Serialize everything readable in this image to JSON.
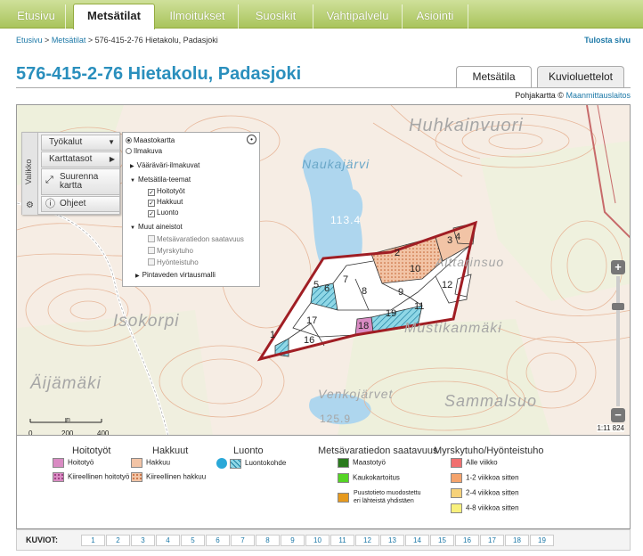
{
  "nav": {
    "tabs": [
      {
        "label": "Etusivu"
      },
      {
        "label": "Metsätilat"
      },
      {
        "label": "Ilmoitukset"
      },
      {
        "label": "Suosikit"
      },
      {
        "label": "Vahtipalvelu"
      },
      {
        "label": "Asiointi"
      }
    ],
    "active_index": 1
  },
  "breadcrumb": {
    "items": [
      "Etusivu",
      "Metsätilat",
      "576-415-2-76 Hietakolu, Padasjoki"
    ],
    "separator": ">"
  },
  "print_link": "Tulosta sivu",
  "page_title": "576-415-2-76 Hietakolu, Padasjoki",
  "page_tabs": [
    {
      "label": "Metsätila",
      "active": true
    },
    {
      "label": "Kuvioluettelot",
      "active": false
    }
  ],
  "attribution": {
    "text": "Pohjakartta ©",
    "link": "Maanmittauslaitos"
  },
  "map": {
    "place_names": [
      "Huhkainvuori",
      "Naukajärvi",
      "Aittarinsuo",
      "Isokorpi",
      "Mustikanmäki",
      "Äijämäki",
      "Venkojärvet",
      "Sammalsuo"
    ],
    "elevations": [
      "113.4",
      "125.9",
      "125.9"
    ],
    "parcels": [
      "1",
      "2",
      "3",
      "4",
      "5",
      "6",
      "7",
      "8",
      "9",
      "10",
      "11",
      "12",
      "16",
      "17",
      "18",
      "19"
    ],
    "toolbar": {
      "vallikko": "Valikko",
      "tools_label": "Työkalut",
      "layers_label": "Karttatasot",
      "enlarge_label": "Suurenna kartta",
      "help_label": "Ohjeet"
    },
    "layers": {
      "base_options": [
        {
          "label": "Maastokartta",
          "selected": true
        },
        {
          "label": "Ilmakuva",
          "selected": false
        }
      ],
      "vaaravari": "Vääräväri-ilmakuvat",
      "theme_group": "Metsätila-teemat",
      "themes": [
        {
          "label": "Hoitotyöt",
          "checked": true
        },
        {
          "label": "Hakkuut",
          "checked": true
        },
        {
          "label": "Luonto",
          "checked": true
        }
      ],
      "other_group": "Muut aineistot",
      "other": [
        {
          "label": "Metsävaratiedon saatavuus",
          "checked": false
        },
        {
          "label": "Myrskytuho",
          "checked": false
        },
        {
          "label": "Hyönteistuho",
          "checked": false
        }
      ],
      "flow_model": "Pintaveden virtausmalli"
    },
    "scale": {
      "ticks": [
        "0",
        "200",
        "400"
      ],
      "unit": "m",
      "ratio": "1:11 824"
    }
  },
  "legend": {
    "hoitotyot": {
      "title": "Hoitotyöt",
      "items": [
        {
          "label": "Hoitotyö",
          "color": "#d98bc3"
        },
        {
          "label": "Kiireellinen hoitotyö",
          "color": "#d98bc3",
          "pattern": "dots"
        }
      ]
    },
    "hakkuut": {
      "title": "Hakkuut",
      "items": [
        {
          "label": "Hakkuu",
          "color": "#f2c4a6"
        },
        {
          "label": "Kiireellinen hakkuu",
          "color": "#f2c4a6",
          "pattern": "dots"
        }
      ]
    },
    "luonto": {
      "title": "Luonto",
      "items": [
        {
          "label": "Luontokohde",
          "color": "#8fd7e6"
        }
      ]
    },
    "metsavara": {
      "title": "Metsävaratiedon saatavuus",
      "items": [
        {
          "label": "Maastotyö",
          "color": "#2a7a1e"
        },
        {
          "label": "Kaukokartoitus",
          "color": "#55d425"
        },
        {
          "label": "Puustotieto muodostettu eri lähteistä yhdistäen",
          "color": "#e69a1e"
        }
      ]
    },
    "myrsky": {
      "title": "Myrskytuho/Hyönteistuho",
      "items": [
        {
          "label": "Alle viikko",
          "color": "#f07070"
        },
        {
          "label": "1-2 viikkoa sitten",
          "color": "#f4a36c"
        },
        {
          "label": "2-4 viikkoa sitten",
          "color": "#f6d27a"
        },
        {
          "label": "4-8 viikkoa sitten",
          "color": "#f8f07c"
        }
      ]
    }
  },
  "kuviot": {
    "label": "KUVIOT:",
    "items": [
      "1",
      "2",
      "3",
      "4",
      "5",
      "6",
      "7",
      "8",
      "9",
      "10",
      "11",
      "12",
      "13",
      "14",
      "15",
      "16",
      "17",
      "18",
      "19"
    ]
  }
}
